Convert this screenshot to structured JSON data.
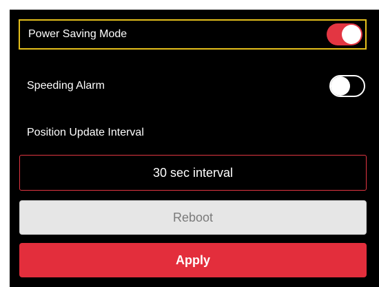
{
  "settings": {
    "power_saving": {
      "label": "Power Saving Mode",
      "enabled": true
    },
    "speeding_alarm": {
      "label": "Speeding Alarm",
      "enabled": false
    },
    "position_update": {
      "label": "Position Update Interval",
      "value": "30 sec interval"
    }
  },
  "buttons": {
    "reboot_label": "Reboot",
    "apply_label": "Apply"
  },
  "colors": {
    "accent": "#e33642",
    "highlight": "#e5c01c",
    "background": "#000000"
  }
}
